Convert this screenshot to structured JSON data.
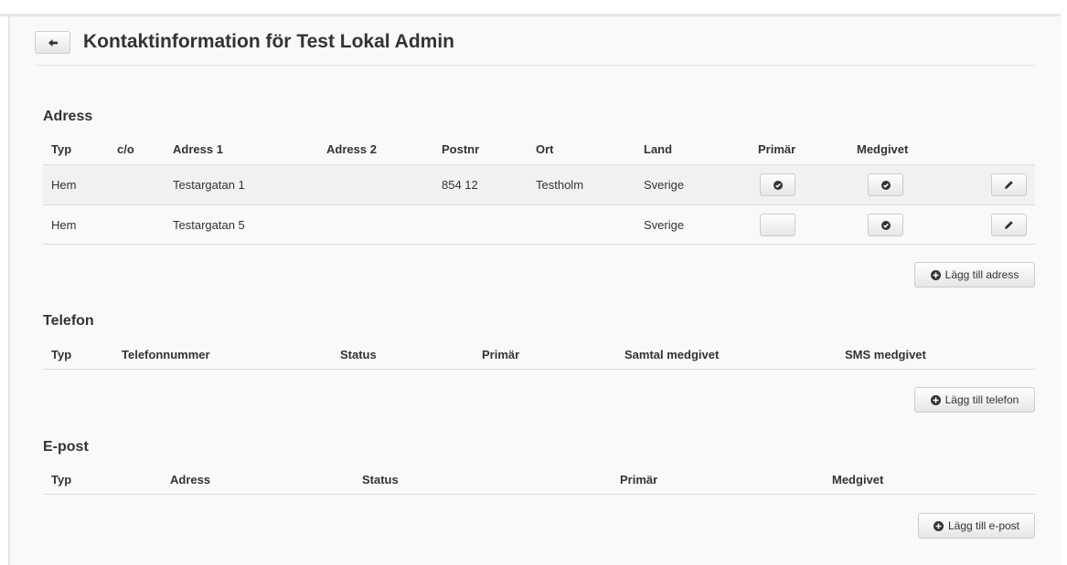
{
  "page": {
    "title": "Kontaktinformation för Test Lokal Admin"
  },
  "icons": {
    "back": "arrow-left-icon",
    "check": "ok-sign-icon",
    "edit": "pencil-icon",
    "add": "plus-sign-icon"
  },
  "address": {
    "section_title": "Adress",
    "columns": {
      "type": "Typ",
      "co": "c/o",
      "address1": "Adress 1",
      "address2": "Adress 2",
      "postcode": "Postnr",
      "city": "Ort",
      "country": "Land",
      "primary": "Primär",
      "consent": "Medgivet"
    },
    "rows": [
      {
        "type": "Hem",
        "co": "",
        "address1": "Testargatan 1",
        "address2": "",
        "postcode": "854 12",
        "city": "Testholm",
        "country": "Sverige",
        "primary": true,
        "consent": true
      },
      {
        "type": "Hem",
        "co": "",
        "address1": "Testargatan 5",
        "address2": "",
        "postcode": "",
        "city": "",
        "country": "Sverige",
        "primary": false,
        "consent": true
      }
    ],
    "add_label": "Lägg till adress"
  },
  "phone": {
    "section_title": "Telefon",
    "columns": {
      "type": "Typ",
      "number": "Telefonnummer",
      "status": "Status",
      "primary": "Primär",
      "call_consent": "Samtal medgivet",
      "sms_consent": "SMS medgivet"
    },
    "add_label": "Lägg till telefon"
  },
  "email": {
    "section_title": "E-post",
    "columns": {
      "type": "Typ",
      "address": "Adress",
      "status": "Status",
      "primary": "Primär",
      "consent": "Medgivet"
    },
    "add_label": "Lägg till e-post"
  },
  "colors": {
    "panel_bg": "#f9f9f9",
    "row_shade": "#f1f1f1",
    "border": "#dddddd",
    "text": "#333333"
  }
}
